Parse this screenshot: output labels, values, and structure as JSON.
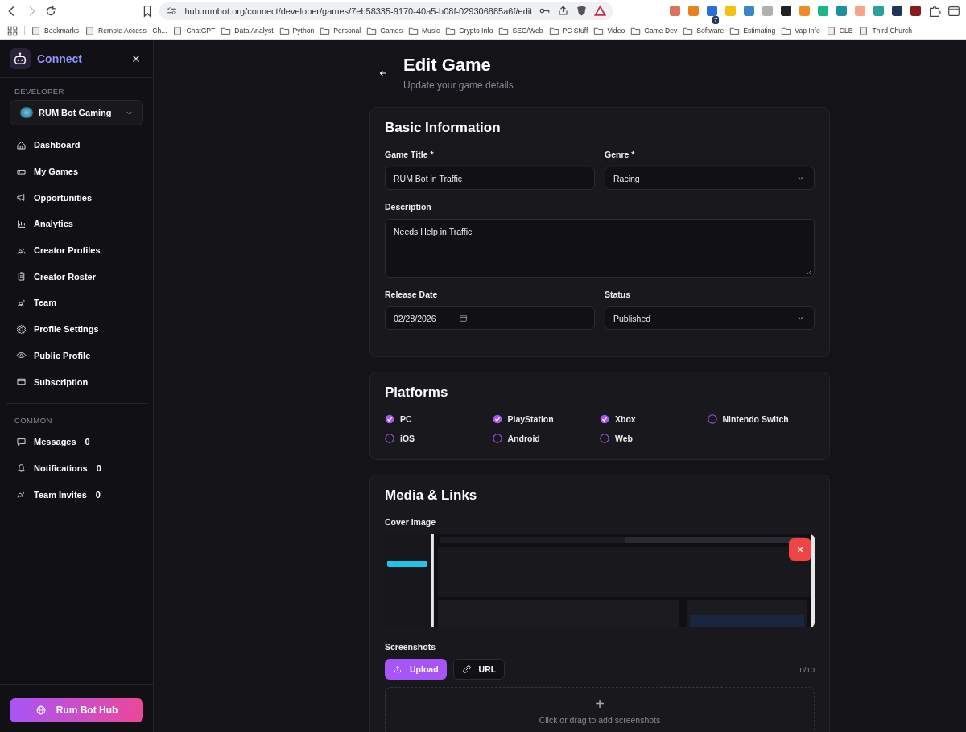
{
  "browser": {
    "url": "hub.rumbot.org/connect/developer/games/7eb58335-9170-40a5-b08f-029306885a6f/edit",
    "bookmarks": [
      {
        "label": "Bookmarks",
        "kind": "page"
      },
      {
        "label": "Remote Access - Ch...",
        "kind": "page"
      },
      {
        "label": "ChatGPT",
        "kind": "page"
      },
      {
        "label": "Data Analyst",
        "kind": "folder"
      },
      {
        "label": "Python",
        "kind": "folder"
      },
      {
        "label": "Personal",
        "kind": "folder"
      },
      {
        "label": "Games",
        "kind": "folder"
      },
      {
        "label": "Music",
        "kind": "folder"
      },
      {
        "label": "Crypto Info",
        "kind": "folder"
      },
      {
        "label": "SEO/Web",
        "kind": "folder"
      },
      {
        "label": "PC Stuff",
        "kind": "folder"
      },
      {
        "label": "Video",
        "kind": "folder"
      },
      {
        "label": "Game Dev",
        "kind": "folder"
      },
      {
        "label": "Software",
        "kind": "folder"
      },
      {
        "label": "Estimating",
        "kind": "folder"
      },
      {
        "label": "Vap Info",
        "kind": "folder"
      },
      {
        "label": "CLB",
        "kind": "page"
      },
      {
        "label": "Third Church",
        "kind": "page"
      }
    ],
    "extensions": [
      {
        "color": "#d9735b"
      },
      {
        "color": "#e8821e"
      },
      {
        "color": "#2a6fd6",
        "badge": "7"
      },
      {
        "color": "#f4c20d"
      },
      {
        "color": "#3a86c8"
      },
      {
        "color": "#b0b0b0"
      },
      {
        "color": "#222222"
      },
      {
        "color": "#f08a24"
      },
      {
        "color": "#1bb58a"
      },
      {
        "color": "#1f8fa0"
      },
      {
        "color": "#f5a38a"
      },
      {
        "color": "#2aa198"
      },
      {
        "color": "#1d3557"
      },
      {
        "color": "#8b1a1a"
      }
    ]
  },
  "sidebar": {
    "brand": "Connect",
    "section": "DEVELOPER",
    "organization": "RUM Bot Gaming",
    "items": [
      {
        "label": "Dashboard"
      },
      {
        "label": "My Games"
      },
      {
        "label": "Opportunities"
      },
      {
        "label": "Analytics"
      },
      {
        "label": "Creator Profiles"
      },
      {
        "label": "Creator Roster"
      },
      {
        "label": "Team"
      },
      {
        "label": "Profile Settings"
      },
      {
        "label": "Public Profile"
      },
      {
        "label": "Subscription"
      }
    ],
    "common_section": "COMMON",
    "common_items": [
      {
        "label": "Messages",
        "count": "0"
      },
      {
        "label": "Notifications",
        "count": "0"
      },
      {
        "label": "Team Invites",
        "count": "0"
      }
    ],
    "hub_button": "Rum Bot Hub"
  },
  "page": {
    "title": "Edit Game",
    "subtitle": "Update your game details"
  },
  "basic_information": {
    "heading": "Basic Information",
    "game_title": {
      "label": "Game Title *",
      "value": "RUM Bot in Traffic"
    },
    "genre": {
      "label": "Genre *",
      "value": "Racing"
    },
    "description": {
      "label": "Description",
      "value": "Needs Help in Traffic"
    },
    "release_date": {
      "label": "Release Date",
      "value": "02/28/2026"
    },
    "status": {
      "label": "Status",
      "value": "Published"
    }
  },
  "platforms": {
    "heading": "Platforms",
    "options": [
      {
        "label": "PC",
        "checked": true
      },
      {
        "label": "PlayStation",
        "checked": true
      },
      {
        "label": "Xbox",
        "checked": true
      },
      {
        "label": "Nintendo Switch",
        "checked": false
      },
      {
        "label": "iOS",
        "checked": false
      },
      {
        "label": "Android",
        "checked": false
      },
      {
        "label": "Web",
        "checked": false
      }
    ]
  },
  "media_links": {
    "heading": "Media & Links",
    "cover_image": {
      "label": "Cover Image",
      "kind": "picture"
    },
    "screenshots": {
      "label": "Screenshots",
      "upload_button": "Upload",
      "url_button": "URL",
      "count": "0/10",
      "dropzone_icon": "+",
      "dropzone_text": "Click or drag to add screenshots"
    }
  }
}
